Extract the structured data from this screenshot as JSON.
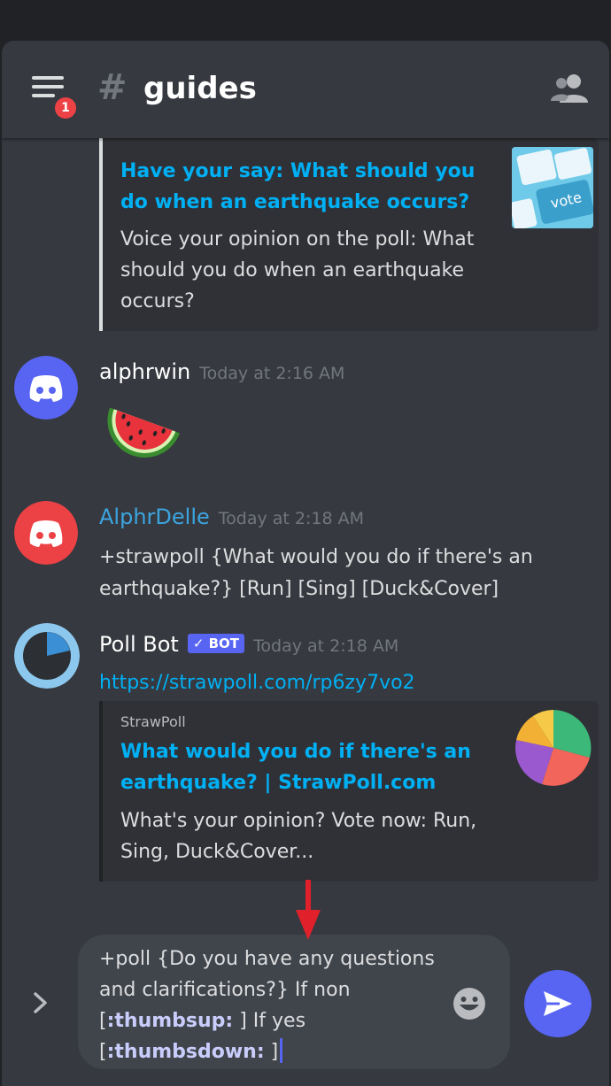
{
  "header": {
    "channel_hash": "#",
    "channel_name": "guides",
    "notification_count": "1"
  },
  "messages": {
    "embed_earthquake": {
      "title": "Have your say: What should you do when an earthquake occurs?",
      "description": "Voice your opinion on the poll:  What should you do when an earthquake occurs?",
      "thumb_text": "vote"
    },
    "alphrwin": {
      "username": "alphrwin",
      "timestamp": "Today at 2:16 AM"
    },
    "alphrdelle": {
      "username": "AlphrDelle",
      "timestamp": "Today at 2:18 AM",
      "text": "+strawpoll {What would you do if there's an earthquake?} [Run] [Sing] [Duck&Cover]"
    },
    "pollbot": {
      "username": "Poll Bot",
      "bot_tag": "BOT",
      "timestamp": "Today at 2:18 AM",
      "link": "https://strawpoll.com/rp6zy7vo2",
      "embed_provider": "StrawPoll",
      "embed_title": "What would you do if there's an earthquake? | StrawPoll.com",
      "embed_description": "What's your opinion? Vote now: Run, Sing, Duck&Cover..."
    }
  },
  "composer": {
    "line1": "+poll {Do you have any questions and clarifications?} If non",
    "thumbsup_open": "[",
    "thumbsup": ":thumbsup:",
    "thumbsup_close": " ] If yes",
    "thumbsdown_open": "[",
    "thumbsdown": ":thumbsdown:",
    "thumbsdown_close": " ]"
  },
  "colors": {
    "background": "#36393f",
    "link": "#00b0f4",
    "blurple": "#5865f2",
    "red": "#ed4245",
    "alphrdelle_name": "#3ba5e0"
  },
  "icons": [
    "hamburger-icon",
    "members-icon",
    "discord-logo-icon",
    "watermelon-icon",
    "expand-chevron-icon",
    "emoji-icon",
    "send-icon",
    "red-arrow-icon"
  ]
}
